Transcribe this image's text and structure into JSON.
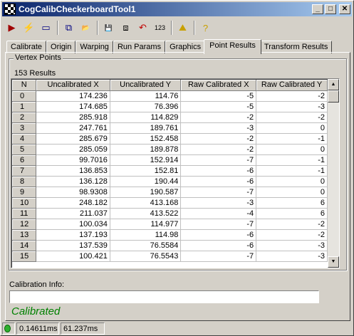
{
  "window": {
    "title": "CogCalibCheckerboardTool1",
    "minimize": "_",
    "maximize": "□",
    "close": "✕"
  },
  "toolbar": {
    "buttons": [
      {
        "name": "run-icon",
        "glyph": "▶",
        "color": "#a00000"
      },
      {
        "name": "lightning-icon",
        "glyph": "⚡",
        "color": "#c8a000"
      },
      {
        "name": "image-buffer-icon",
        "glyph": "▭",
        "color": "#000080"
      },
      {
        "name": "overlay-icon",
        "glyph": "⧉",
        "color": "#000080"
      },
      {
        "name": "open-icon",
        "glyph": "📂",
        "color": "#c8a000"
      },
      {
        "name": "save-icon",
        "glyph": "💾",
        "color": "#000080"
      },
      {
        "name": "save-as-icon",
        "glyph": "⧈",
        "color": "#000000"
      },
      {
        "name": "reset-icon",
        "glyph": "↶",
        "color": "#c00000"
      },
      {
        "name": "counter-icon",
        "glyph": "123",
        "color": "#000000"
      },
      {
        "name": "image-view-icon",
        "glyph": "⛰",
        "color": "#c8a000"
      },
      {
        "name": "help-icon",
        "glyph": "?",
        "color": "#c8a000"
      }
    ]
  },
  "tabs": [
    {
      "label": "Calibrate"
    },
    {
      "label": "Origin"
    },
    {
      "label": "Warping"
    },
    {
      "label": "Run Params"
    },
    {
      "label": "Graphics"
    },
    {
      "label": "Point Results",
      "active": true
    },
    {
      "label": "Transform Results"
    }
  ],
  "vertex_points": {
    "group_label": "Vertex Points",
    "count_label": "153 Results",
    "columns": [
      "N",
      "Uncalibrated X",
      "Uncalibrated Y",
      "Raw Calibrated X",
      "Raw Calibrated Y"
    ],
    "rows": [
      [
        "0",
        "174.236",
        "114.76",
        "-5",
        "-2"
      ],
      [
        "1",
        "174.685",
        "76.396",
        "-5",
        "-3"
      ],
      [
        "2",
        "285.918",
        "114.829",
        "-2",
        "-2"
      ],
      [
        "3",
        "247.761",
        "189.761",
        "-3",
        "0"
      ],
      [
        "4",
        "285.679",
        "152.458",
        "-2",
        "-1"
      ],
      [
        "5",
        "285.059",
        "189.878",
        "-2",
        "0"
      ],
      [
        "6",
        "99.7016",
        "152.914",
        "-7",
        "-1"
      ],
      [
        "7",
        "136.853",
        "152.81",
        "-6",
        "-1"
      ],
      [
        "8",
        "136.128",
        "190.44",
        "-6",
        "0"
      ],
      [
        "9",
        "98.9308",
        "190.587",
        "-7",
        "0"
      ],
      [
        "10",
        "248.182",
        "413.168",
        "-3",
        "6"
      ],
      [
        "11",
        "211.037",
        "413.522",
        "-4",
        "6"
      ],
      [
        "12",
        "100.034",
        "114.977",
        "-7",
        "-2"
      ],
      [
        "13",
        "137.193",
        "114.98",
        "-6",
        "-2"
      ],
      [
        "14",
        "137.539",
        "76.5584",
        "-6",
        "-3"
      ],
      [
        "15",
        "100.421",
        "76.5543",
        "-7",
        "-3"
      ]
    ]
  },
  "calibration_info_label": "Calibration Info:",
  "calibration_info_value": "",
  "status_text": "Calibrated",
  "statusbar": {
    "time1": "0.14611ms",
    "time2": "61.237ms"
  },
  "colors": {
    "status_green": "#008000",
    "title_gradient_start": "#0a246a",
    "title_gradient_end": "#a6caf0"
  }
}
